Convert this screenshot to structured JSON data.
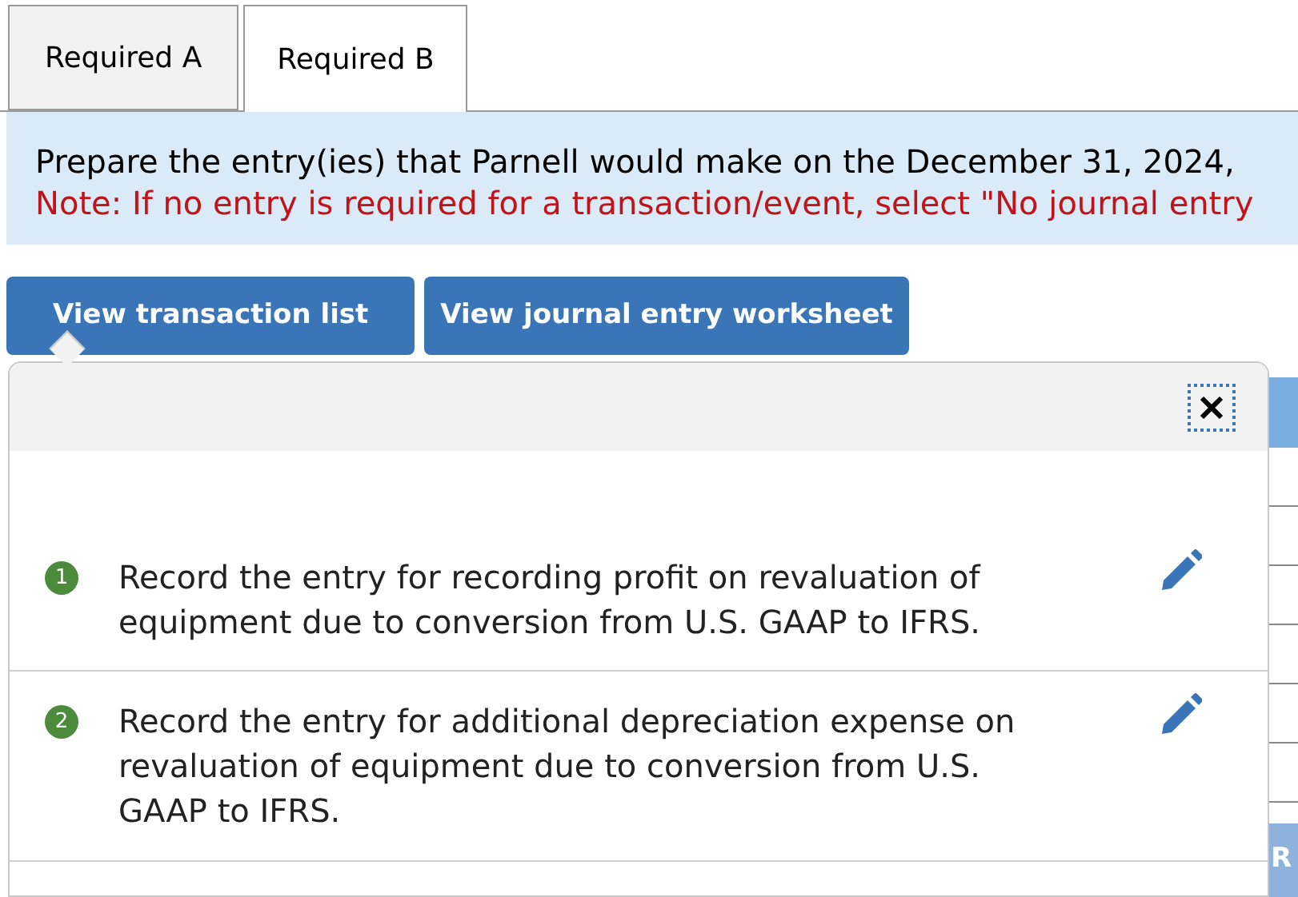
{
  "tabs": [
    {
      "label": "Required A",
      "selected": false
    },
    {
      "label": "Required B",
      "selected": true
    }
  ],
  "instructions": {
    "text": "Prepare the entry(ies) that Parnell would make on the December 31, 2024,",
    "note": "Note: If no entry is required for a transaction/event, select \"No journal entry"
  },
  "buttons": [
    {
      "label": "View transaction list",
      "selected": true
    },
    {
      "label": "View journal entry worksheet",
      "selected": false
    }
  ],
  "transaction_list": {
    "items": [
      {
        "number": "1",
        "text": "Record the entry for recording profit on revaluation of equipment due to conversion from U.S. GAAP to IFRS."
      },
      {
        "number": "2",
        "text": "Record the entry for additional depreciation expense on revaluation of equipment due to conversion from U.S. GAAP to IFRS."
      }
    ]
  },
  "worksheet_behind": {
    "button_label": "R"
  }
}
